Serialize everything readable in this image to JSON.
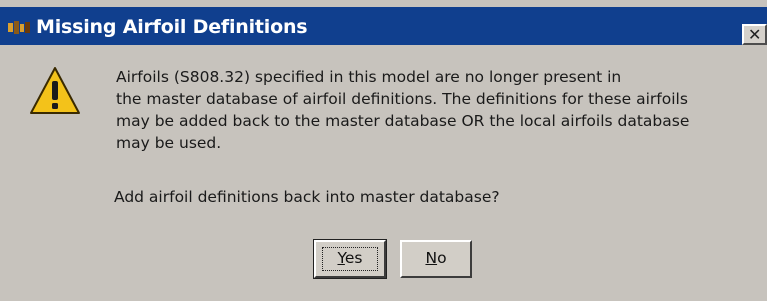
{
  "dialog": {
    "title": "Missing Airfoil Definitions",
    "close_icon": "close-icon",
    "warning_icon": "warning-icon",
    "message_lines": [
      "Airfoils (S808.32) specified in this model are no longer present in",
      "the master database of airfoil definitions.  The definitions for these airfoils",
      "may be added back to the master database OR the local airfoils database",
      "may be used."
    ],
    "question": "Add airfoil definitions back into master database?",
    "buttons": {
      "yes": {
        "accel": "Y",
        "rest": "es"
      },
      "no": {
        "accel": "N",
        "rest": "o"
      }
    }
  },
  "colors": {
    "titlebar": "#103f8e",
    "background": "#c7c3bd",
    "warning_fill": "#f3c21a"
  }
}
